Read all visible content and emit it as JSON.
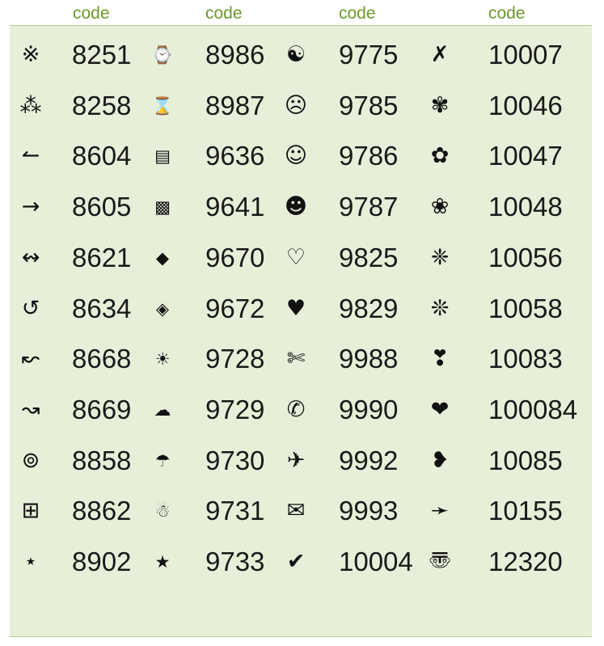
{
  "headers": [
    "code",
    "code",
    "code",
    "code"
  ],
  "columns": [
    {
      "rows": [
        {
          "symbol": "※",
          "code": "8251",
          "icon": "reference-mark-icon"
        },
        {
          "symbol": "⁂",
          "code": "8258",
          "icon": "asterism-icon"
        },
        {
          "symbol": "↼",
          "code": "8604",
          "icon": "wave-arrow-left-icon"
        },
        {
          "symbol": "→",
          "code": "8605",
          "icon": "wave-arrow-right-icon"
        },
        {
          "symbol": "↭",
          "code": "8621",
          "icon": "left-right-wave-arrow-icon"
        },
        {
          "symbol": "↺",
          "code": "8634",
          "icon": "anticlockwise-arrow-icon"
        },
        {
          "symbol": "↜",
          "code": "8668",
          "icon": "squiggle-arrow-left-icon"
        },
        {
          "symbol": "↝",
          "code": "8669",
          "icon": "squiggle-arrow-right-icon"
        },
        {
          "symbol": "⊚",
          "code": "8858",
          "icon": "circled-ring-icon"
        },
        {
          "symbol": "⊞",
          "code": "8862",
          "icon": "squared-plus-icon"
        },
        {
          "symbol": "⋆",
          "code": "8902",
          "icon": "star-operator-icon"
        }
      ]
    },
    {
      "rows": [
        {
          "symbol": "⌚",
          "code": "8986",
          "icon": "watch-icon"
        },
        {
          "symbol": "⌛",
          "code": "8987",
          "icon": "hourglass-icon"
        },
        {
          "symbol": "▤",
          "code": "9636",
          "icon": "striped-square-icon"
        },
        {
          "symbol": "▩",
          "code": "9641",
          "icon": "crosshatch-square-icon"
        },
        {
          "symbol": "◆",
          "code": "9670",
          "icon": "black-diamond-icon"
        },
        {
          "symbol": "◈",
          "code": "9672",
          "icon": "diamond-in-diamond-icon"
        },
        {
          "symbol": "☀",
          "code": "9728",
          "icon": "sun-icon"
        },
        {
          "symbol": "☁",
          "code": "9729",
          "icon": "cloud-icon"
        },
        {
          "symbol": "☂",
          "code": "9730",
          "icon": "umbrella-icon"
        },
        {
          "symbol": "☃",
          "code": "9731",
          "icon": "snowman-icon"
        },
        {
          "symbol": "★",
          "code": "9733",
          "icon": "black-star-icon"
        }
      ]
    },
    {
      "rows": [
        {
          "symbol": "☯",
          "code": "9775",
          "icon": "yin-yang-icon"
        },
        {
          "symbol": "☹",
          "code": "9785",
          "icon": "frowning-face-icon"
        },
        {
          "symbol": "☺",
          "code": "9786",
          "icon": "smiling-face-icon"
        },
        {
          "symbol": "☻",
          "code": "9787",
          "icon": "black-smiling-face-icon"
        },
        {
          "symbol": "♡",
          "code": "9825",
          "icon": "white-heart-icon"
        },
        {
          "symbol": "♥",
          "code": "9829",
          "icon": "black-heart-icon"
        },
        {
          "symbol": "✄",
          "code": "9988",
          "icon": "scissors-icon"
        },
        {
          "symbol": "✆",
          "code": "9990",
          "icon": "telephone-location-icon"
        },
        {
          "symbol": "✈",
          "code": "9992",
          "icon": "airplane-icon"
        },
        {
          "symbol": "✉",
          "code": "9993",
          "icon": "envelope-icon"
        },
        {
          "symbol": "✔",
          "code": "10004",
          "icon": "check-mark-icon"
        }
      ]
    },
    {
      "rows": [
        {
          "symbol": "✗",
          "code": "10007",
          "icon": "ballot-x-icon"
        },
        {
          "symbol": "✾",
          "code": "10046",
          "icon": "florette-icon"
        },
        {
          "symbol": "✿",
          "code": "10047",
          "icon": "black-florette-icon"
        },
        {
          "symbol": "❀",
          "code": "10048",
          "icon": "white-florette-icon"
        },
        {
          "symbol": "❈",
          "code": "10056",
          "icon": "sparkle-icon"
        },
        {
          "symbol": "❊",
          "code": "10058",
          "icon": "teardrop-asterisk-icon"
        },
        {
          "symbol": "❣",
          "code": "10083",
          "icon": "heart-exclamation-icon"
        },
        {
          "symbol": "❤",
          "code": "100084",
          "icon": "heavy-heart-icon"
        },
        {
          "symbol": "❥",
          "code": "10085",
          "icon": "rotated-heart-icon"
        },
        {
          "symbol": "➛",
          "code": "10155",
          "icon": "drafting-arrow-icon"
        },
        {
          "symbol": "〠",
          "code": "12320",
          "icon": "postal-mark-face-icon"
        }
      ]
    }
  ]
}
